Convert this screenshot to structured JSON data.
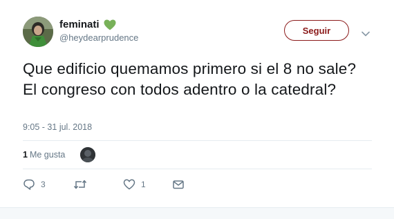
{
  "author": {
    "display_name": "feminati",
    "handle": "@heydearprudence",
    "emoji": "green-heart-icon"
  },
  "follow_button": {
    "label": "Seguir"
  },
  "tweet": {
    "text": "Que edificio quemamos primero si el 8 no sale? El congreso con todos adentro o la catedral?",
    "timestamp": "9:05 - 31 jul. 2018"
  },
  "likes": {
    "count": "1",
    "label": "Me gusta"
  },
  "actions": {
    "reply_count": "3",
    "retweet_count": "",
    "like_count": "1"
  },
  "colors": {
    "accent": "#8b1a1a",
    "heart_green": "#78b159",
    "muted": "#657786"
  }
}
